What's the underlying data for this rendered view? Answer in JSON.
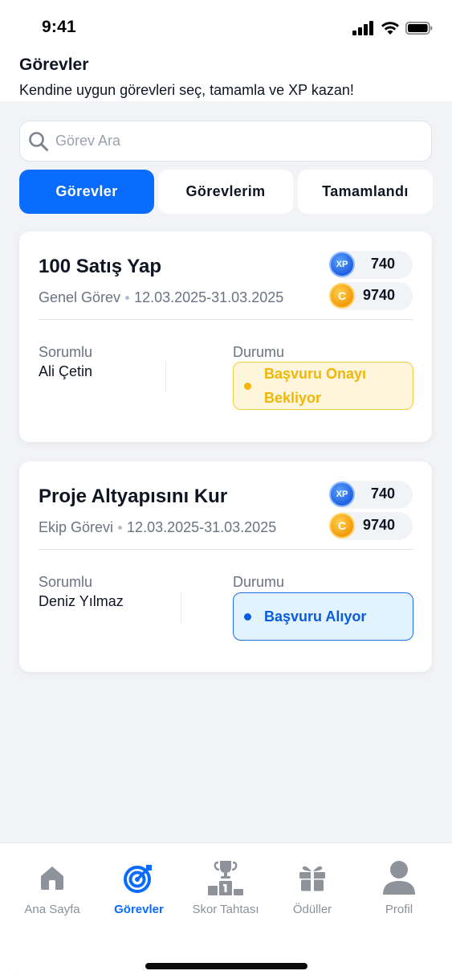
{
  "status_bar": {
    "time": "9:41"
  },
  "header": {
    "title": "Görevler",
    "subtitle": "Kendine uygun görevleri seç, tamamla ve XP kazan!"
  },
  "search": {
    "placeholder": "Görev Ara",
    "value": ""
  },
  "tabs": [
    {
      "label": "Görevler",
      "active": true
    },
    {
      "label": "Görevlerim",
      "active": false
    },
    {
      "label": "Tamamlandı",
      "active": false
    }
  ],
  "tasks": [
    {
      "title": "100 Satış Yap",
      "type": "Genel Görev",
      "dates": "12.03.2025-31.03.2025",
      "xp": "740",
      "coins": "9740",
      "xp_badge": "XP",
      "coin_badge": "C",
      "responsible_label": "Sorumlu",
      "responsible": "Ali Çetin",
      "status_label": "Durumu",
      "status": "Başvuru Onayı Bekliyor",
      "status_color": "#f2b705"
    },
    {
      "title": "Proje Altyapısını Kur",
      "type": "Ekip Görevi",
      "dates": "12.03.2025-31.03.2025",
      "xp": "740",
      "coins": "9740",
      "xp_badge": "XP",
      "coin_badge": "C",
      "responsible_label": "Sorumlu",
      "responsible": "Deniz Yılmaz",
      "status_label": "Durumu",
      "status": "Başvuru Alıyor",
      "status_color": "#0a5cdc"
    }
  ],
  "bottom_nav": [
    {
      "label": "Ana Sayfa",
      "icon": "home-icon",
      "active": false
    },
    {
      "label": "Görevler",
      "icon": "target-icon",
      "active": true
    },
    {
      "label": "Skor Tahtası",
      "icon": "trophy-podium-icon",
      "active": false
    },
    {
      "label": "Ödüller",
      "icon": "gift-icon",
      "active": false
    },
    {
      "label": "Profil",
      "icon": "user-icon",
      "active": false
    }
  ],
  "colors": {
    "accent": "#0a6cff",
    "background": "#f2f3f6",
    "pending": "#f2b705",
    "open": "#0a5cdc"
  }
}
